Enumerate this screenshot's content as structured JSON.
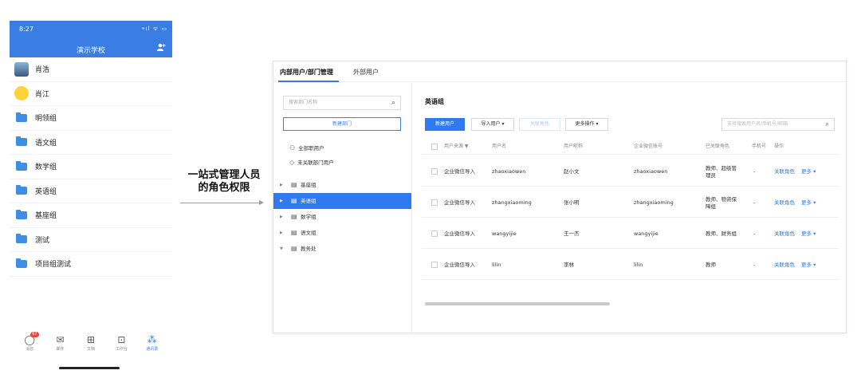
{
  "phone": {
    "time": "8:27",
    "status_icons": "•ıl ᯤ ▭",
    "title": "演示学校",
    "list": [
      {
        "label": "肖浩",
        "kind": "avatar"
      },
      {
        "label": "肖江",
        "kind": "avatar"
      },
      {
        "label": "明领组",
        "kind": "folder"
      },
      {
        "label": "语文组",
        "kind": "folder"
      },
      {
        "label": "数学组",
        "kind": "folder"
      },
      {
        "label": "英语组",
        "kind": "folder"
      },
      {
        "label": "基座组",
        "kind": "folder"
      },
      {
        "label": "测试",
        "kind": "folder"
      },
      {
        "label": "项目组测试",
        "kind": "folder"
      }
    ],
    "tabbar": [
      {
        "label": "消息",
        "icon": "chat-icon",
        "badge": "67"
      },
      {
        "label": "邮件",
        "icon": "mail-icon"
      },
      {
        "label": "文档",
        "icon": "doc-icon"
      },
      {
        "label": "工作台",
        "icon": "grid-icon"
      },
      {
        "label": "通讯录",
        "icon": "contacts-icon",
        "active": true
      }
    ]
  },
  "caption": {
    "line1": "一站式管理人员",
    "line2": "的角色权限"
  },
  "admin": {
    "tabs": [
      "内部用户/部门管理",
      "外部用户"
    ],
    "dept_search_placeholder": "搜索部门名称",
    "new_dept_label": "新建部门",
    "filters": [
      "全部职用户",
      "未关联部门用户"
    ],
    "tree": [
      {
        "label": "基座组",
        "expanded": false
      },
      {
        "label": "英语组",
        "expanded": false,
        "selected": true
      },
      {
        "label": "数学组",
        "expanded": false
      },
      {
        "label": "语文组",
        "expanded": false
      },
      {
        "label": "教务处",
        "expanded": true
      }
    ],
    "group_title": "英语组",
    "toolbar": {
      "new_user": "新建用户",
      "import_user": "导入用户 ▾",
      "link_role": "关联角色",
      "more_ops": "更多操作 ▾",
      "search_placeholder": "支持搜索用户名/手机号/邮箱"
    },
    "columns": [
      "用户来源 ▼",
      "用户名",
      "用户昵称",
      "企业微信账号",
      "已关联角色",
      "手机号",
      "操作"
    ],
    "rows": [
      {
        "source": "企业微信导入",
        "username": "zhaoxiaowen",
        "nickname": "赵小文",
        "wecom": "zhaoxiaowen",
        "roles": "教师、超级管理员",
        "phone": "-",
        "action_link": "关联角色",
        "action_more": "更多 ▾"
      },
      {
        "source": "企业微信导入",
        "username": "zhangxiaoming",
        "nickname": "张小明",
        "wecom": "zhangxiaoming",
        "roles": "教师、物资保障组",
        "phone": "-",
        "action_link": "关联角色",
        "action_more": "更多 ▾"
      },
      {
        "source": "企业微信导入",
        "username": "wangyijie",
        "nickname": "王一杰",
        "wecom": "wangyijie",
        "roles": "教师、财务组",
        "phone": "-",
        "action_link": "关联角色",
        "action_more": "更多 ▾"
      },
      {
        "source": "企业微信导入",
        "username": "lilin",
        "nickname": "李林",
        "wecom": "lilin",
        "roles": "教师",
        "phone": "-",
        "action_link": "关联角色",
        "action_more": "更多 ▾"
      }
    ]
  }
}
